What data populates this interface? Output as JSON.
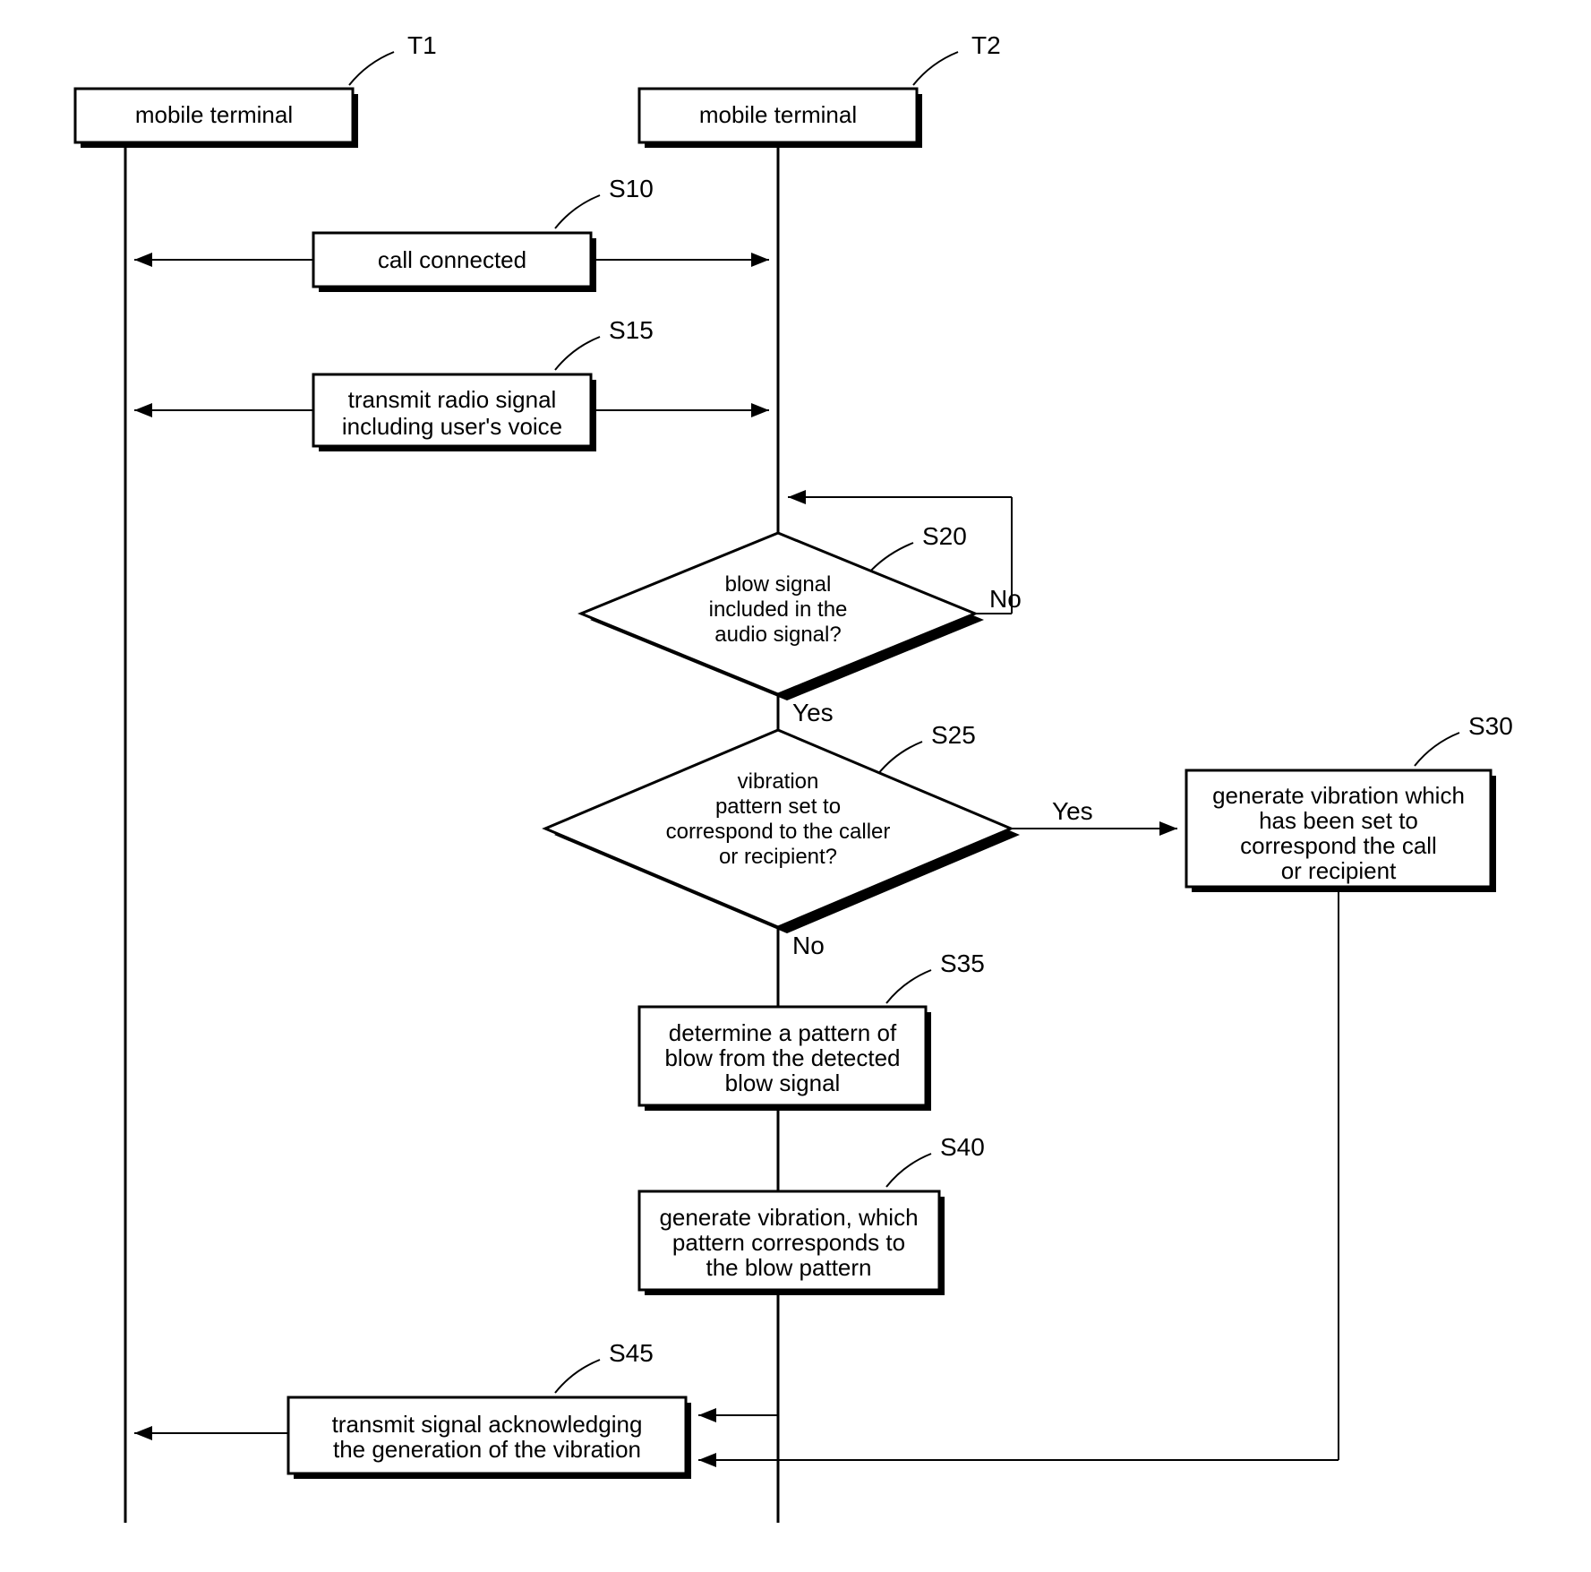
{
  "labels": {
    "t1": "T1",
    "t2": "T2",
    "s10": "S10",
    "s15": "S15",
    "s20": "S20",
    "s25": "S25",
    "s30": "S30",
    "s35": "S35",
    "s40": "S40",
    "s45": "S45"
  },
  "boxes": {
    "t1": "mobile terminal",
    "t2": "mobile terminal",
    "s10": "call connected",
    "s15_line1": "transmit radio signal",
    "s15_line2": "including user's voice",
    "s20_line1": "blow signal",
    "s20_line2": "included in the",
    "s20_line3": "audio signal?",
    "s25_line1": "vibration",
    "s25_line2": "pattern set to",
    "s25_line3": "correspond to the caller",
    "s25_line4": "or recipient?",
    "s30_line1": "generate vibration which",
    "s30_line2": "has been set to",
    "s30_line3": "correspond the call",
    "s30_line4": "or recipient",
    "s35_line1": "determine a pattern of",
    "s35_line2": "blow from the detected",
    "s35_line3": "blow signal",
    "s40_line1": "generate vibration, which",
    "s40_line2": "pattern corresponds to",
    "s40_line3": "the blow pattern",
    "s45_line1": "transmit signal acknowledging",
    "s45_line2": "the generation of the vibration"
  },
  "branches": {
    "yes": "Yes",
    "no": "No"
  }
}
